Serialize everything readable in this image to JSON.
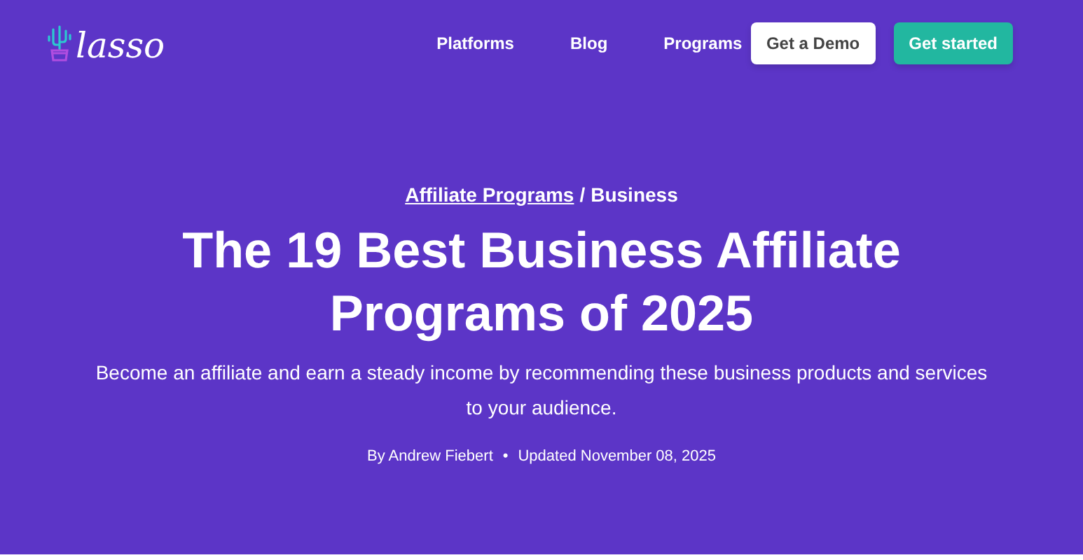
{
  "header": {
    "logo": "lasso",
    "nav": [
      "Platforms",
      "Blog",
      "Programs"
    ],
    "buttons": [
      {
        "label": "Get a Demo",
        "kind": "secondary"
      },
      {
        "label": "Get started",
        "kind": "primary"
      }
    ]
  },
  "hero": {
    "breadcrumb": [
      {
        "label": "Affiliate Programs",
        "kind": "link"
      },
      {
        "label": "Business",
        "kind": "current"
      }
    ],
    "separator": "/",
    "title": "The 19 Best Business Affiliate Programs of 2025",
    "subtitle": "Become an affiliate and earn a steady income by recommending these business products and services to your audience.",
    "byline": "By Andrew Fiebert",
    "bullet": "•",
    "updated": "Updated November 08, 2025"
  }
}
